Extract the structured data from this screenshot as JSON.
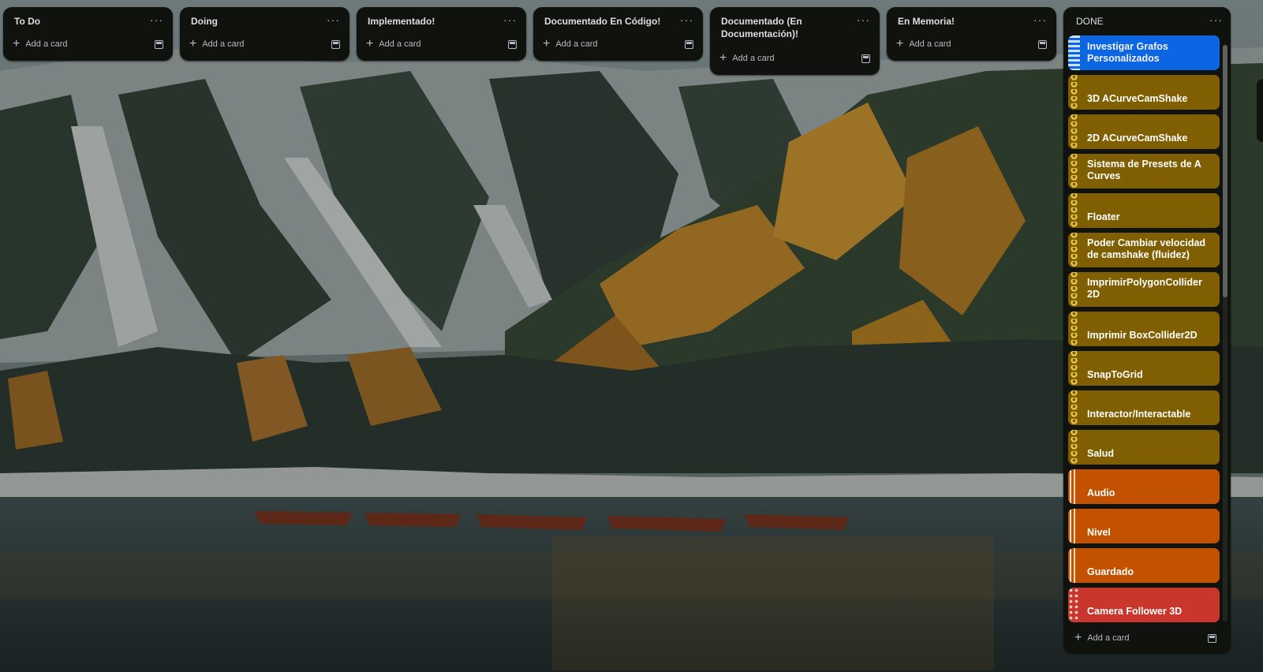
{
  "lists": [
    {
      "title": "To Do",
      "add_label": "Add a card"
    },
    {
      "title": "Doing",
      "add_label": "Add a card"
    },
    {
      "title": "Implementado!",
      "add_label": "Add a card"
    },
    {
      "title": "Documentado En Código!",
      "add_label": "Add a card"
    },
    {
      "title": "Documentado (En Documentación)!",
      "add_label": "Add a card"
    },
    {
      "title": "En Memoria!",
      "add_label": "Add a card"
    }
  ],
  "done_list": {
    "title": "DONE",
    "add_label": "Add a card",
    "cards": [
      {
        "label": "Investigar Grafos Personalizados",
        "color": "#0c66e4",
        "pattern": "stripes"
      },
      {
        "label": "3D ACurveCamShake",
        "color": "#7f5f01",
        "pattern": "ornament"
      },
      {
        "label": "2D ACurveCamShake",
        "color": "#7f5f01",
        "pattern": "ornament"
      },
      {
        "label": "Sistema de Presets de A Curves",
        "color": "#7f5f01",
        "pattern": "ornament"
      },
      {
        "label": "Floater",
        "color": "#7f5f01",
        "pattern": "ornament"
      },
      {
        "label": "Poder Cambiar velocidad de camshake (fluidez)",
        "color": "#7f5f01",
        "pattern": "ornament"
      },
      {
        "label": "ImprimirPolygonCollider 2D",
        "color": "#7f5f01",
        "pattern": "ornament"
      },
      {
        "label": "Imprimir BoxCollider2D",
        "color": "#7f5f01",
        "pattern": "ornament"
      },
      {
        "label": "SnapToGrid",
        "color": "#7f5f01",
        "pattern": "ornament"
      },
      {
        "label": "Interactor/Interactable",
        "color": "#7f5f01",
        "pattern": "ornament"
      },
      {
        "label": "Salud",
        "color": "#7f5f01",
        "pattern": "ornament"
      },
      {
        "label": "Audio",
        "color": "#c25100",
        "pattern": "bars"
      },
      {
        "label": "Nivel",
        "color": "#c25100",
        "pattern": "bars"
      },
      {
        "label": "Guardado",
        "color": "#c25100",
        "pattern": "bars"
      },
      {
        "label": "Camera Follower 3D",
        "color": "#c9372c",
        "pattern": "dots"
      }
    ]
  },
  "icons": {
    "list_menu": "ellipsis-icon",
    "add": "plus-icon",
    "template": "card-template-icon"
  },
  "theme": {
    "list_bg": "#0f120d",
    "blue": "#0c66e4",
    "olive": "#7f5f01",
    "orange": "#c25100",
    "red": "#c9372c"
  }
}
